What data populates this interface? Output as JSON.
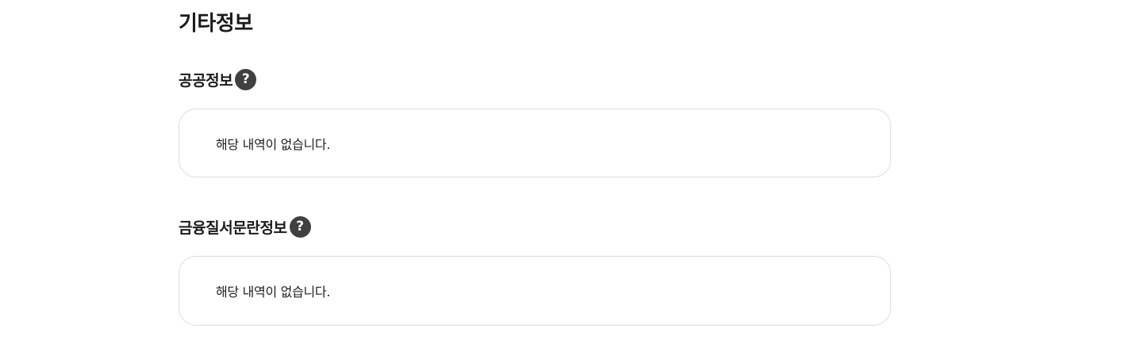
{
  "page": {
    "title": "기타정보"
  },
  "sections": [
    {
      "title": "공공정보",
      "help_icon": "question-mark-icon",
      "empty_message": "해당 내역이 없습니다."
    },
    {
      "title": "금융질서문란정보",
      "help_icon": "question-mark-icon",
      "empty_message": "해당 내역이 없습니다."
    }
  ],
  "colors": {
    "text": "#1b1b1b",
    "help_icon_bg": "#404040",
    "box_border": "#dcdcdc"
  }
}
